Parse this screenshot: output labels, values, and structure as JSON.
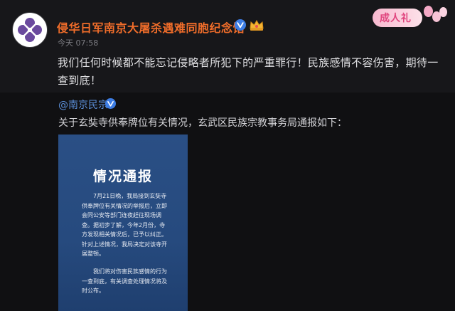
{
  "post": {
    "username": "侵华日军南京大屠杀遇难同胞纪念馆",
    "time": "今天 07:58",
    "content": "我们任何时候都不能忘记侵略者所犯下的严重罪行！民族感情不容伤害，期待一查到底！",
    "verified_icon": "verified-v-icon",
    "badge_icon": "crown-badge-icon",
    "avatar_icon": "memorial-logo-icon"
  },
  "decoration": {
    "label": "成人礼",
    "icon": "balloons-icon"
  },
  "repost": {
    "author": "@南京民宗",
    "verified_icon": "verified-v-icon",
    "text": "关于玄奘寺供奉牌位有关情况，玄武区民族宗教事务局通报如下：",
    "image": {
      "title": "情况通报",
      "paragraph1": "7月21日晚，我局接到玄奘寺供奉牌位有关情况的举报后，立即会同公安等部门连夜赶往现场调查。据初步了解，今年2月份，寺方发现相关情况后，已予以纠正。针对上述情况，我局决定对该寺开展整顿。",
      "paragraph2": "我们将对伤害民族感情的行为一查到底，有关调查处理情况将及时公布。"
    }
  },
  "colors": {
    "username": "#f06d2a",
    "link": "#5b8fd9",
    "notice_bg": "#264a7e",
    "avatar_logo": "#6b4a9e"
  }
}
